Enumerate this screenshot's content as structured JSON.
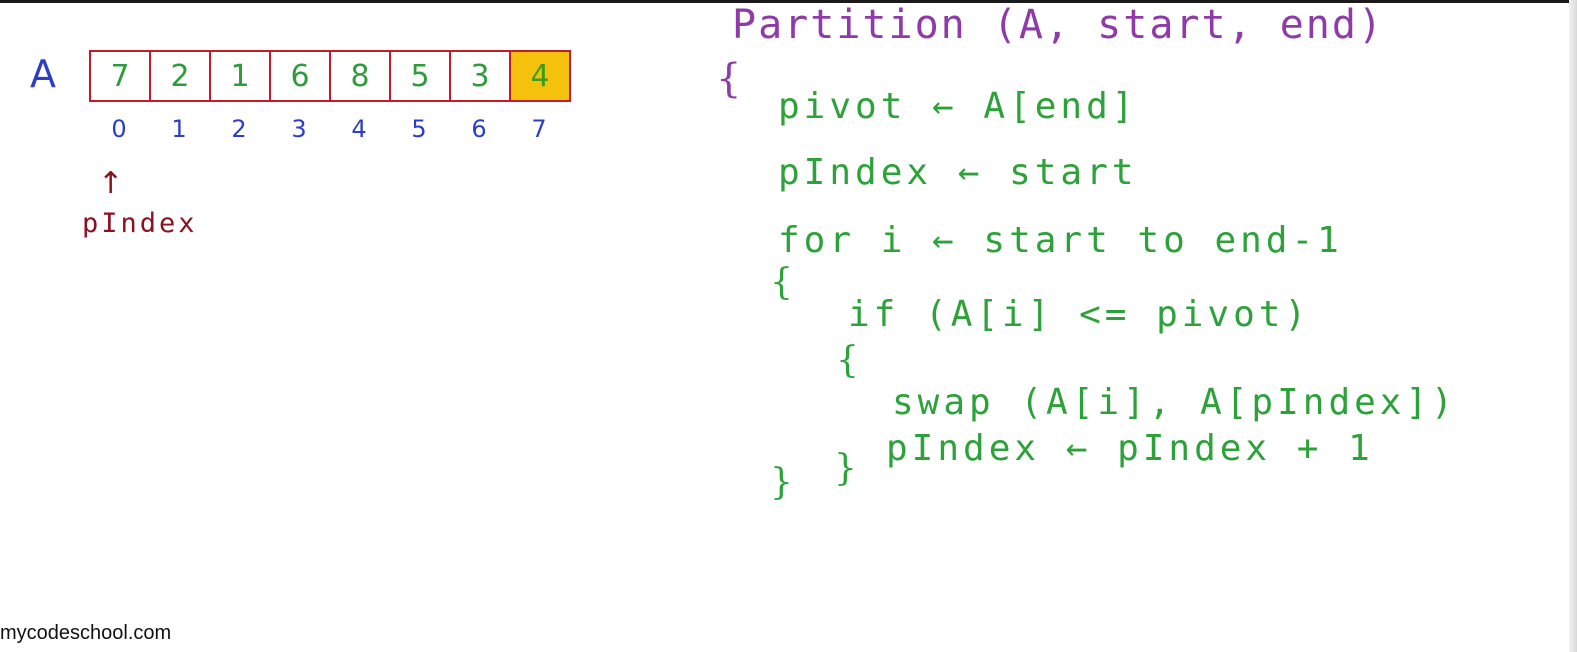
{
  "array": {
    "name": "A",
    "cells": [
      {
        "value": "7",
        "highlight": false
      },
      {
        "value": "2",
        "highlight": false
      },
      {
        "value": "1",
        "highlight": false
      },
      {
        "value": "6",
        "highlight": false
      },
      {
        "value": "8",
        "highlight": false
      },
      {
        "value": "5",
        "highlight": false
      },
      {
        "value": "3",
        "highlight": false
      },
      {
        "value": "4",
        "highlight": true
      }
    ],
    "indices": [
      "0",
      "1",
      "2",
      "3",
      "4",
      "5",
      "6",
      "7"
    ],
    "pointer": {
      "arrow": "↑",
      "label": "pIndex",
      "at_index": 0
    }
  },
  "code": {
    "title": "Partition (A, start, end)",
    "brace_fn_open": "{",
    "lines": {
      "pivot_assign": "pivot ← A[end]",
      "pindex_assign": "pIndex ← start",
      "for_loop": "for i ← start to end-1",
      "for_open": "{",
      "if_stmt": "if (A[i] <= pivot)",
      "if_open": "{",
      "swap_stmt": "swap (A[i], A[pIndex])",
      "increment": "pIndex ← pIndex + 1",
      "if_close": "}",
      "for_close": "}"
    }
  },
  "footer": {
    "text": "mycodeschool.com"
  },
  "colors": {
    "array_border": "#c41a2b",
    "cell_text": "#2e9c3a",
    "pivot_fill": "#f4c20d",
    "index_text": "#2b3ec6",
    "pointer": "#8b1220",
    "title": "#8e3aa8",
    "code": "#2ea23a"
  }
}
